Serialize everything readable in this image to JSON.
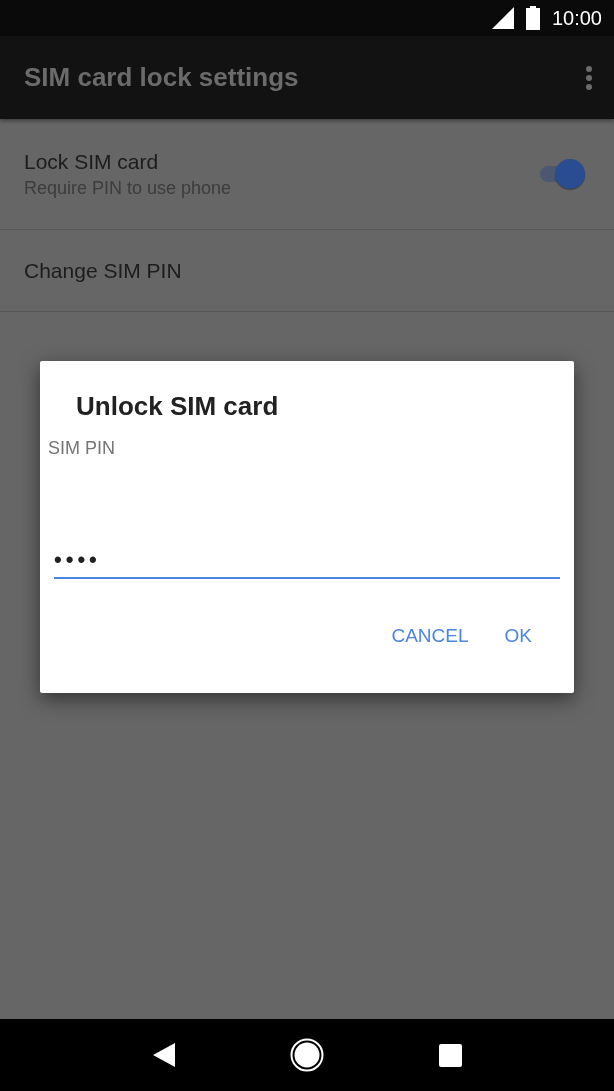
{
  "status_bar": {
    "time": "10:00"
  },
  "app_bar": {
    "title": "SIM card lock settings"
  },
  "settings": [
    {
      "kind": "switch",
      "title": "Lock SIM card",
      "summary": "Require PIN to use phone",
      "on": true
    },
    {
      "kind": "plain",
      "title": "Change SIM PIN"
    }
  ],
  "dialog": {
    "title": "Unlock SIM card",
    "field_label": "SIM PIN",
    "value": "••••",
    "focused": true,
    "buttons": [
      "CANCEL",
      "OK"
    ]
  }
}
